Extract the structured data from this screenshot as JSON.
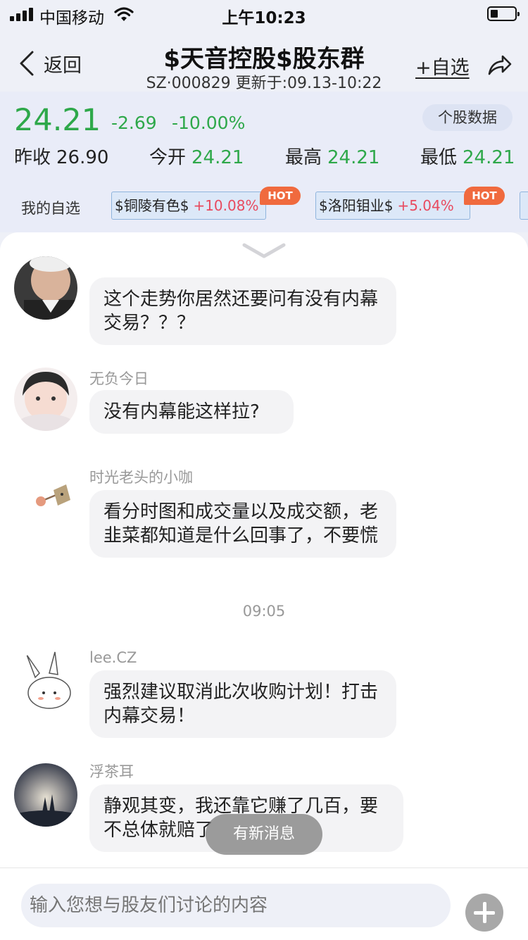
{
  "status_bar": {
    "carrier": "中国移动",
    "time": "上午10:23"
  },
  "nav": {
    "back_label": "返回",
    "title": "$天音控股$股东群",
    "subtitle": "SZ·000829 更新于:09.13-10:22",
    "add_watch_label": "+自选"
  },
  "quote": {
    "price": "24.21",
    "change": "-2.69",
    "change_pct": "-10.00%",
    "stock_data_button": "个股数据",
    "stats": [
      {
        "label": "昨收",
        "value": "26.90"
      },
      {
        "label": "今开",
        "value": "24.21"
      },
      {
        "label": "最高",
        "value": "24.21"
      },
      {
        "label": "最低",
        "value": "24.21"
      }
    ],
    "watchlist_label": "我的自选",
    "watchlist": [
      {
        "name": "$铜陵有色$",
        "change": "+10.08%",
        "badge": "HOT"
      },
      {
        "name": "$洛阳钼业$",
        "change": "+5.04%",
        "badge": "HOT"
      }
    ]
  },
  "chat": {
    "messages": [
      {
        "user": "",
        "text": "这个走势你居然还要问有没有内幕交易？？？"
      },
      {
        "user": "无负今日",
        "text": "没有内幕能这样拉?"
      },
      {
        "user": "时光老头的小咖",
        "text": "看分时图和成交量以及成交额，老韭菜都知道是什么回事了，不要慌"
      },
      {
        "user": "lee.CZ",
        "text": "强烈建议取消此次收购计划！打击内幕交易！"
      },
      {
        "user": "浮茶耳",
        "text": " 静观其变，我还靠它赚了几百，要不总体就赔了"
      }
    ],
    "timestamp": "09:05",
    "new_message_toast": "有新消息"
  },
  "input": {
    "placeholder": "输入您想与股友们讨论的内容"
  },
  "colors": {
    "down_green": "#2ea84a",
    "up_red": "#e84a5f",
    "hot_orange": "#f06a3e",
    "chip_bg": "#dce8f8"
  }
}
